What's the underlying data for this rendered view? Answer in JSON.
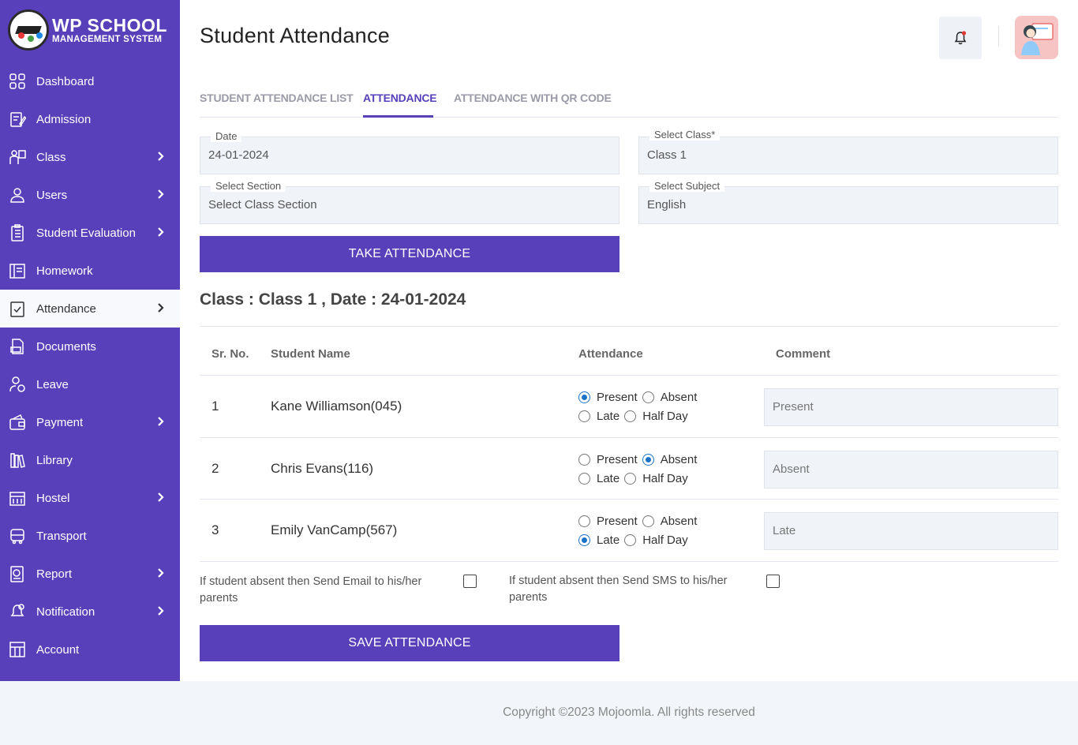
{
  "logo": {
    "title": "WP SCHOOL",
    "subtitle": "MANAGEMENT SYSTEM"
  },
  "sidebar": {
    "items": [
      {
        "label": "Dashboard",
        "icon": "dashboard-icon",
        "chevron": false
      },
      {
        "label": "Admission",
        "icon": "admission-icon",
        "chevron": false
      },
      {
        "label": "Class",
        "icon": "class-icon",
        "chevron": true
      },
      {
        "label": "Users",
        "icon": "user-icon",
        "chevron": true
      },
      {
        "label": "Student Evaluation",
        "icon": "evaluation-icon",
        "chevron": true
      },
      {
        "label": "Homework",
        "icon": "homework-icon",
        "chevron": false
      },
      {
        "label": "Attendance",
        "icon": "attendance-icon",
        "chevron": true,
        "active": true
      },
      {
        "label": "Documents",
        "icon": "documents-icon",
        "chevron": false
      },
      {
        "label": "Leave",
        "icon": "leave-icon",
        "chevron": false
      },
      {
        "label": "Payment",
        "icon": "payment-icon",
        "chevron": true
      },
      {
        "label": "Library",
        "icon": "library-icon",
        "chevron": false
      },
      {
        "label": "Hostel",
        "icon": "hostel-icon",
        "chevron": true
      },
      {
        "label": "Transport",
        "icon": "transport-icon",
        "chevron": false
      },
      {
        "label": "Report",
        "icon": "report-icon",
        "chevron": true
      },
      {
        "label": "Notification",
        "icon": "notification-icon",
        "chevron": true
      },
      {
        "label": "Account",
        "icon": "account-icon",
        "chevron": false
      }
    ]
  },
  "header": {
    "title": "Student Attendance"
  },
  "tabs": [
    {
      "label": "STUDENT ATTENDANCE LIST",
      "active": false
    },
    {
      "label": "ATTENDANCE",
      "active": true
    },
    {
      "label": "ATTENDANCE WITH QR CODE",
      "active": false
    }
  ],
  "form": {
    "date_label": "Date",
    "date_value": "24-01-2024",
    "class_label": "Select Class*",
    "class_value": "Class 1",
    "section_label": "Select Section",
    "section_value": "Select Class Section",
    "subject_label": "Select Subject",
    "subject_value": "English",
    "take_button": "TAKE ATTENDANCE"
  },
  "class_heading": "Class : Class 1 , Date : 24-01-2024",
  "table": {
    "headers": [
      "Sr. No.",
      "Student Name",
      "Attendance",
      "Comment"
    ],
    "options": [
      "Present",
      "Absent",
      "Late",
      "Half Day"
    ],
    "rows": [
      {
        "sr": "1",
        "name": "Kane Williamson(045)",
        "selected": "Present",
        "comment": "Present"
      },
      {
        "sr": "2",
        "name": "Chris Evans(116)",
        "selected": "Absent",
        "comment": "Absent"
      },
      {
        "sr": "3",
        "name": "Emily VanCamp(567)",
        "selected": "Late",
        "comment": "Late"
      }
    ]
  },
  "notify": {
    "email_line1": "If student absent then Send Email to his/her",
    "email_line2": "parents",
    "sms_line1": "If student absent then Send SMS to his/her",
    "sms_line2": "parents"
  },
  "save_button": "SAVE ATTENDANCE",
  "footer": "Copyright ©2023 Mojoomla. All rights reserved",
  "colors": {
    "primary": "#5840bb",
    "radio_selected": "#1a73c8"
  }
}
